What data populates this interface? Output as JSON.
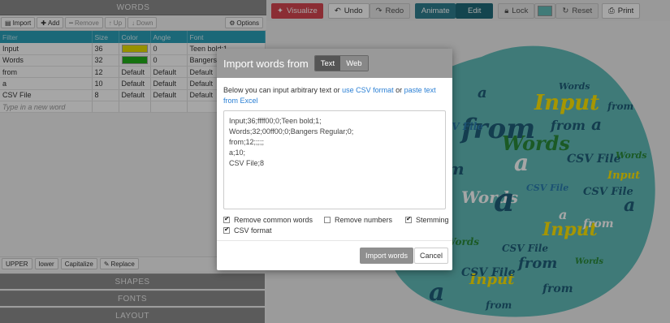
{
  "words_panel": {
    "title": "WORDS",
    "toolbar": {
      "import_label": "Import",
      "add_label": "Add",
      "remove_label": "Remove",
      "up_label": "Up",
      "down_label": "Down",
      "options_label": "Options"
    },
    "table": {
      "headers": [
        "Filter",
        "Size",
        "Color",
        "Angle",
        "Font"
      ],
      "rows": [
        {
          "text": "Input",
          "size": "36",
          "color": "#e7df00",
          "color_label": "",
          "angle": "0",
          "font": "Teen bold;1"
        },
        {
          "text": "Words",
          "size": "32",
          "color": "#22b01a",
          "color_label": "",
          "angle": "0",
          "font": "Bangers R"
        },
        {
          "text": "from",
          "size": "12",
          "color": "",
          "color_label": "Default",
          "angle": "Default",
          "font": "Default"
        },
        {
          "text": "a",
          "size": "10",
          "color": "",
          "color_label": "Default",
          "angle": "Default",
          "font": "Default"
        },
        {
          "text": "CSV File",
          "size": "8",
          "color": "",
          "color_label": "Default",
          "angle": "Default",
          "font": "Default"
        }
      ],
      "new_word_placeholder": "Type in a new word"
    },
    "case_toolbar": {
      "upper_label": "UPPER",
      "lower_label": "lower",
      "capitalize_label": "Capitalize",
      "replace_label": "Replace"
    }
  },
  "sections": {
    "shapes": "SHAPES",
    "fonts": "FONTS",
    "layout": "LAYOUT"
  },
  "top_toolbar": {
    "visualize_label": "Visualize",
    "undo_label": "Undo",
    "redo_label": "Redo",
    "animate_label": "Animate",
    "edit_label": "Edit",
    "lock_label": "Lock",
    "reset_label": "Reset",
    "print_label": "Print",
    "color_chip": "#65bdb8"
  },
  "modal": {
    "title": "Import words from",
    "tabs": [
      {
        "label": "Text",
        "active": true
      },
      {
        "label": "Web",
        "active": false
      }
    ],
    "description_prefix": "Below you can input arbitrary text or ",
    "link_csv": "use CSV format",
    "description_mid": " or ",
    "link_excel": "paste text from Excel",
    "textarea_value": "Input;36;ffff00;0;Teen bold;1;\nWords;32;00ff00;0;Bangers Regular;0;\nfrom;12;;;;;\na;10;\nCSV File;8",
    "options": {
      "remove_common_words": {
        "label": "Remove common words",
        "checked": true
      },
      "remove_numbers": {
        "label": "Remove numbers",
        "checked": false
      },
      "stemming": {
        "label": "Stemming",
        "checked": true
      },
      "csv_format": {
        "label": "CSV format",
        "checked": true
      }
    },
    "import_button": "Import words",
    "cancel_button": "Cancel"
  },
  "cloud_words": [
    "Input",
    "Words",
    "from",
    "a",
    "CSV File"
  ]
}
